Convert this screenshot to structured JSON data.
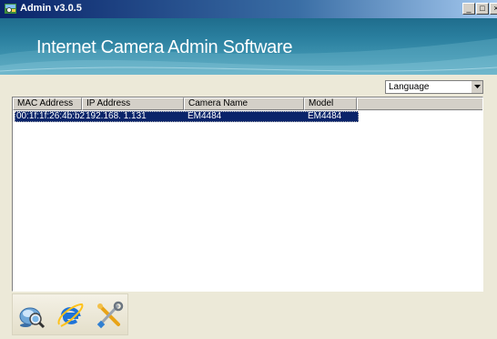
{
  "window": {
    "title": "Admin v3.0.5",
    "min_glyph": "_",
    "max_glyph": "□",
    "close_glyph": "×"
  },
  "banner": {
    "title": "Internet Camera Admin Software"
  },
  "language": {
    "selected": "Language"
  },
  "camera_list": {
    "columns": [
      "MAC Address",
      "IP Address",
      "Camera Name",
      "Model"
    ],
    "rows": [
      {
        "mac": "00:1f:1f:26:4b:b2",
        "ip": "192.168.  1.131",
        "name": "EM4484",
        "model": "EM4484",
        "selected": true
      }
    ]
  },
  "toolbar": {
    "icons": [
      "search-camera-icon",
      "internet-explorer-icon",
      "settings-tools-icon"
    ]
  },
  "colors": {
    "selection": "#0a246a",
    "banner": "#2a7f9f",
    "titlebar": "#0a246a"
  }
}
